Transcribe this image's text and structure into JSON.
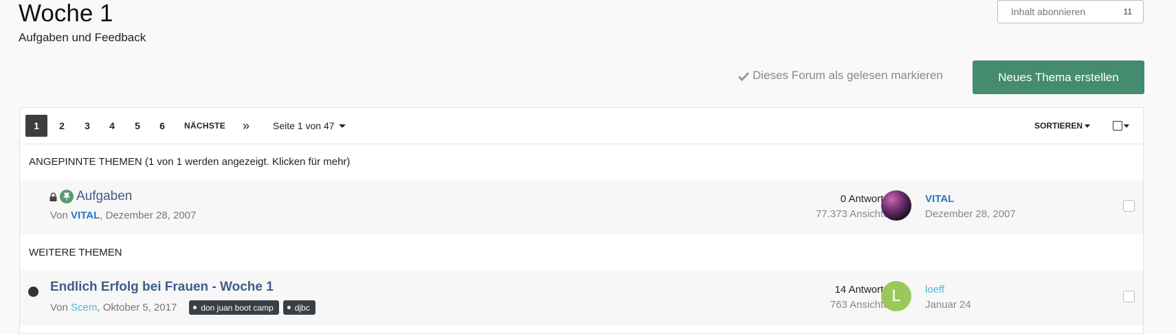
{
  "header": {
    "title": "Woche 1",
    "subtitle": "Aufgaben und Feedback",
    "follow_label": "Inhalt abonnieren",
    "follow_count": "11"
  },
  "actions": {
    "mark_read_label": "Dieses Forum als gelesen markieren",
    "new_topic_label": "Neues Thema erstellen"
  },
  "pagination": {
    "pages": [
      "1",
      "2",
      "3",
      "4",
      "5",
      "6"
    ],
    "active_page": "1",
    "next_label": "NÄCHSTE",
    "last_icon": "»",
    "page_jump_label": "Seite 1 von 47",
    "sort_label": "SORTIEREN"
  },
  "sections": {
    "pinned_header": "ANGEPINNTE THEMEN (1 von 1 werden angezeigt. Klicken für mehr)",
    "other_header": "WEITERE THEMEN"
  },
  "topics": [
    {
      "title": "Aufgaben",
      "by_prefix": "Von",
      "author": "VITAL",
      "date": ", Dezember 28, 2007",
      "replies": "0 Antworten",
      "views": "77.373 Ansichten",
      "last_poster": "VITAL",
      "last_date": "Dezember 28, 2007",
      "pinned": true,
      "locked": true
    },
    {
      "title": "Endlich Erfolg bei Frauen - Woche 1",
      "by_prefix": "Von",
      "author": "Scem",
      "date": ", Oktober 5, 2017",
      "tags": [
        "don juan boot camp",
        "djbc"
      ],
      "replies": "14 Antworten",
      "views": "763 Ansichten",
      "last_poster": "loeff",
      "last_poster_initial": "L",
      "last_date": "Januar 24",
      "unread": true
    }
  ],
  "colors": {
    "primary_button": "#448b6f",
    "link": "#3f5d87",
    "author_link": "#2677c9",
    "pin_badge": "#5b9a6e",
    "avatar_letter_bg": "#9bc85b"
  }
}
